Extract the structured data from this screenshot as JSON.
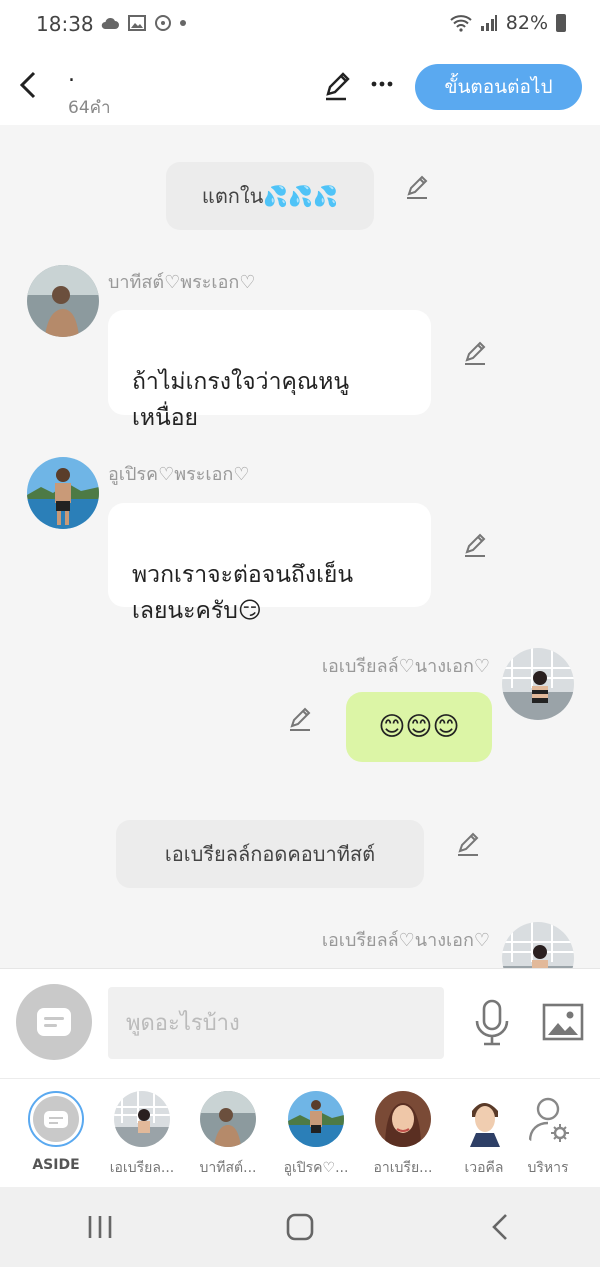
{
  "status_bar": {
    "time": "18:38",
    "battery": "82%"
  },
  "header": {
    "title": ".",
    "word_count": "64คำ",
    "next_label": "ขั้นตอนต่อไป"
  },
  "messages": [
    {
      "type": "narration",
      "text": "แตกใน💦💦💦"
    },
    {
      "type": "left",
      "name": "บาทีสต์♡พระเอก♡",
      "text": "ถ้าไม่เกรงใจว่าคุณหนู\nเหนื่อย"
    },
    {
      "type": "left",
      "name": "อูเปิรค♡พระเอก♡",
      "text": "พวกเราจะต่อจนถึงเย็น\nเลยนะครับ😏"
    },
    {
      "type": "right",
      "name": "เอเบรียลล์♡นางเอก♡",
      "text": "😊😊😊"
    },
    {
      "type": "narration",
      "text": "เอเบรียลล์กอดคอบาทีสต์"
    },
    {
      "type": "right",
      "name": "เอเบรียลล์♡นางเอก♡",
      "text": ""
    }
  ],
  "input": {
    "placeholder": "พูดอะไรบ้าง"
  },
  "characters": [
    {
      "label": "ASIDE"
    },
    {
      "label": "เอเบรียล..."
    },
    {
      "label": "บาทีสต์..."
    },
    {
      "label": "อูเปิรค♡..."
    },
    {
      "label": "อาเบรีย..."
    },
    {
      "label": "เวอคีล"
    },
    {
      "label": "บริหาร"
    }
  ],
  "colors": {
    "accent": "#5aa9f0",
    "right_bubble": "#dcf5a6",
    "narration_bg": "#ececec",
    "background": "#f5f5f5"
  }
}
